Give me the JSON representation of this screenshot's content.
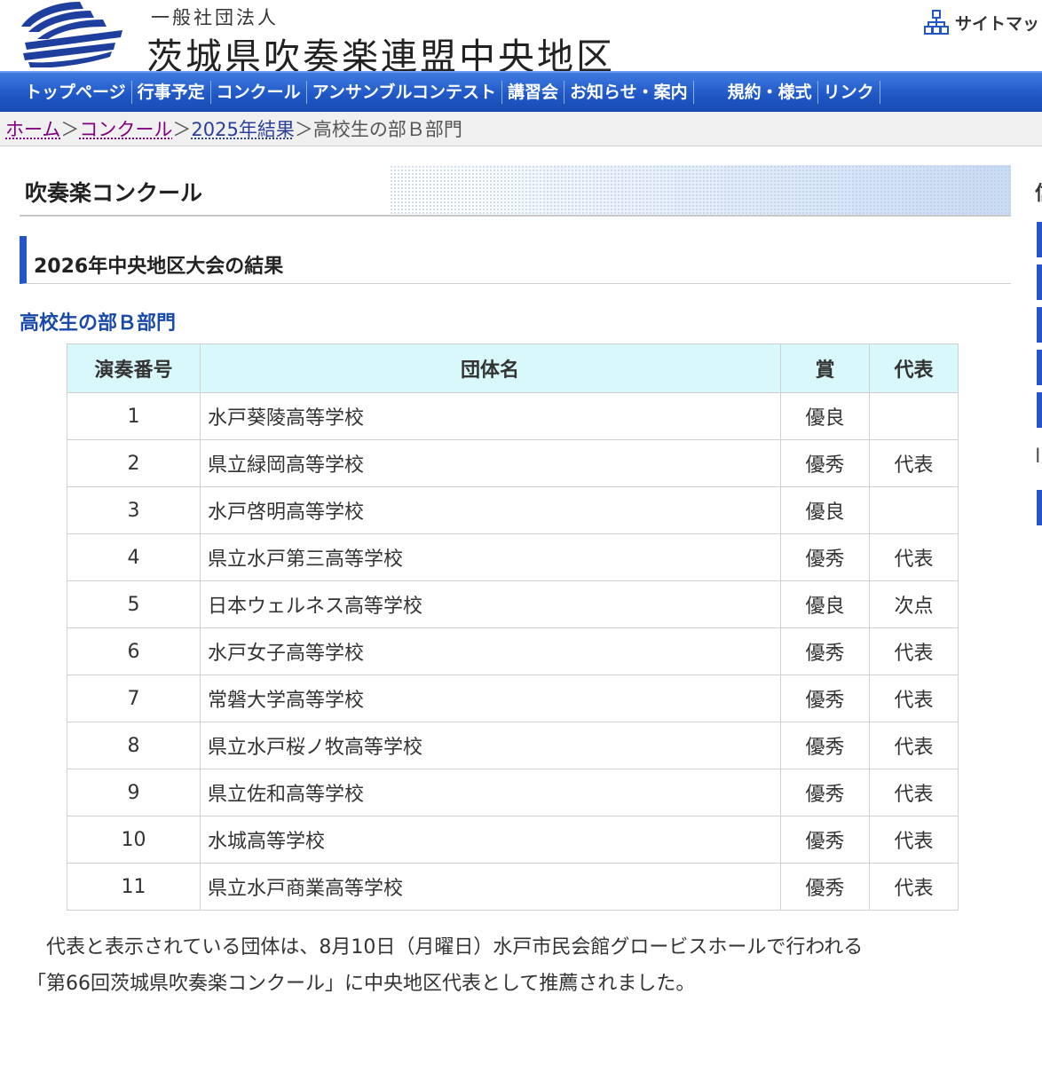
{
  "header": {
    "org_subtitle": "一般社団法人",
    "org_title": "茨城県吹奏楽連盟中央地区",
    "sitemap_label": "サイトマッ",
    "colors": {
      "logo_blue": "#1f3f9e"
    }
  },
  "nav": {
    "items": [
      "トップページ",
      "行事予定",
      "コンクール",
      "アンサンブルコンテスト",
      "講習会",
      "お知らせ・案内",
      "規約・様式",
      "リンク"
    ],
    "colors": {
      "bar": "#1e56c4"
    }
  },
  "breadcrumb": {
    "home": "ホーム",
    "contest": "コンクール",
    "results_2025": "2025年結果",
    "separator": "＞",
    "current": "高校生の部Ｂ部門"
  },
  "page": {
    "section_title": "吹奏楽コンクール",
    "results_title": "2026年中央地区大会の結果",
    "division_title": "高校生の部Ｂ部門"
  },
  "table": {
    "headers": {
      "number": "演奏番号",
      "name": "団体名",
      "award": "賞",
      "rep": "代表"
    },
    "rows": [
      {
        "number": "1",
        "name": "水戸葵陵高等学校",
        "award": "優良",
        "rep": ""
      },
      {
        "number": "2",
        "name": "県立緑岡高等学校",
        "award": "優秀",
        "rep": "代表"
      },
      {
        "number": "3",
        "name": "水戸啓明高等学校",
        "award": "優良",
        "rep": ""
      },
      {
        "number": "4",
        "name": "県立水戸第三高等学校",
        "award": "優秀",
        "rep": "代表"
      },
      {
        "number": "5",
        "name": "日本ウェルネス高等学校",
        "award": "優良",
        "rep": "次点"
      },
      {
        "number": "6",
        "name": "水戸女子高等学校",
        "award": "優秀",
        "rep": "代表"
      },
      {
        "number": "7",
        "name": "常磐大学高等学校",
        "award": "優秀",
        "rep": "代表"
      },
      {
        "number": "8",
        "name": "県立水戸桜ノ牧高等学校",
        "award": "優秀",
        "rep": "代表"
      },
      {
        "number": "9",
        "name": "県立佐和高等学校",
        "award": "優秀",
        "rep": "代表"
      },
      {
        "number": "10",
        "name": "水城高等学校",
        "award": "優秀",
        "rep": "代表"
      },
      {
        "number": "11",
        "name": "県立水戸商業高等学校",
        "award": "優秀",
        "rep": "代表"
      }
    ],
    "colors": {
      "header_bg": "#d9f8fb"
    }
  },
  "note": {
    "line1": "代表と表示されている団体は、8月10日（月曜日）水戸市民会館グロービスホールで行われる",
    "line2": "「第66回茨城県吹奏楽コンクール」に中央地区代表として推薦されました。"
  },
  "sidebar": {
    "heading_fragment": "信",
    "item_fragment": "I"
  }
}
